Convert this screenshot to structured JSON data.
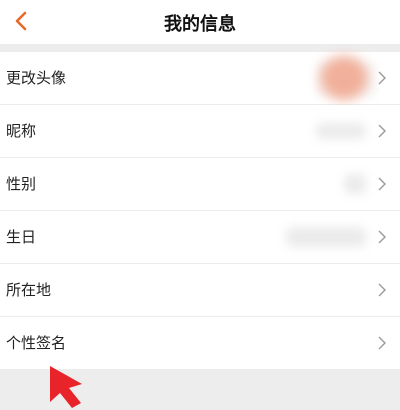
{
  "header": {
    "title": "我的信息"
  },
  "rows": [
    {
      "label": "更改头像"
    },
    {
      "label": "昵称"
    },
    {
      "label": "性别"
    },
    {
      "label": "生日"
    },
    {
      "label": "所在地"
    },
    {
      "label": "个性签名"
    }
  ],
  "colors": {
    "accent": "#e8692a",
    "pointer": "#e8242a"
  },
  "icons": {
    "back": "chevron-left-icon",
    "row_arrow": "chevron-right-icon",
    "cursor": "arrow-pointer-icon"
  }
}
